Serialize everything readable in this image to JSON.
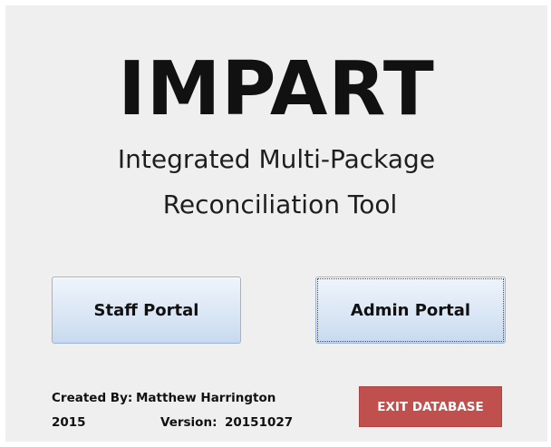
{
  "app": {
    "title": "IMPART",
    "subtitle_line1": "Integrated Multi-Package",
    "subtitle_line2": "Reconciliation Tool"
  },
  "buttons": {
    "staff_portal": "Staff Portal",
    "admin_portal": "Admin Portal",
    "exit": "EXIT DATABASE"
  },
  "footer": {
    "created_by_label": "Created By:",
    "created_by_name": "Matthew Harrington",
    "year": "2015",
    "version_label": "Version:",
    "version_value": "20151027"
  },
  "colors": {
    "background": "#efefef",
    "portal_button": "#dbe7f5",
    "exit_button": "#c0504d"
  }
}
